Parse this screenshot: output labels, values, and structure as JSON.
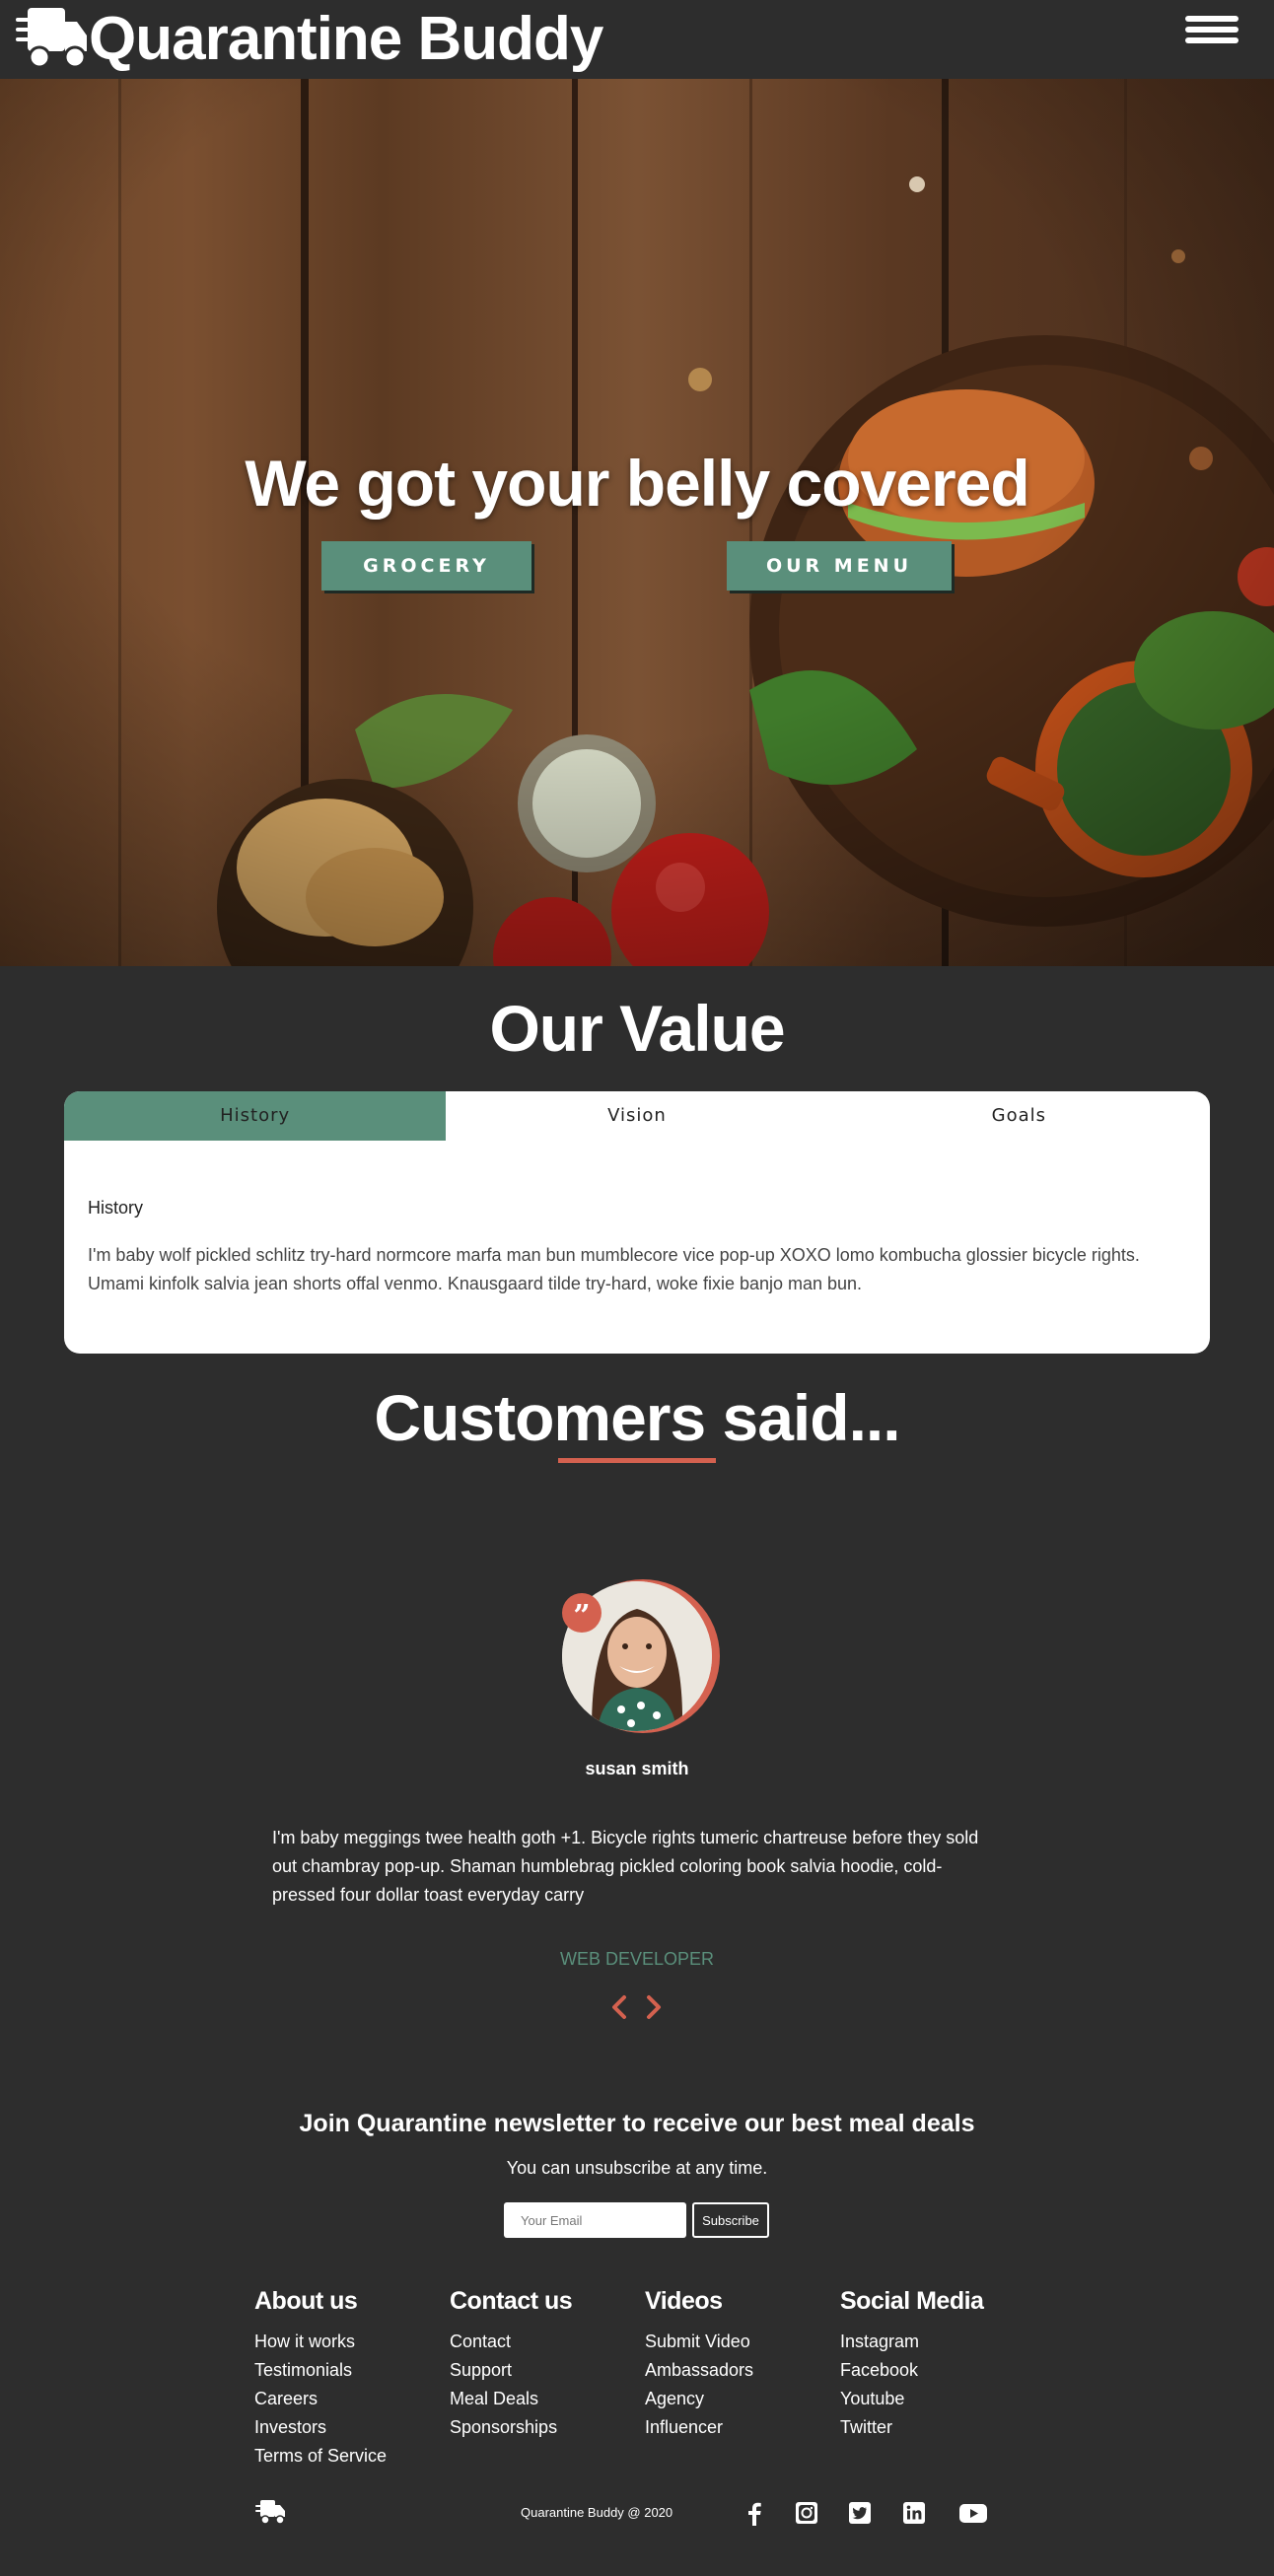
{
  "nav": {
    "brand": "Quarantine Buddy"
  },
  "hero": {
    "headline": "We got your belly covered",
    "buttons": {
      "grocery": "GROCERY",
      "menu": "OUR MENU"
    }
  },
  "value": {
    "title": "Our Value",
    "tabs": [
      "History",
      "Vision",
      "Goals"
    ],
    "active_heading": "History",
    "active_text": "I'm baby wolf pickled schlitz try-hard normcore marfa man bun mumblecore vice pop-up XOXO lomo kombucha glossier bicycle rights. Umami kinfolk salvia jean shorts offal venmo. Knausgaard tilde try-hard, woke fixie banjo man bun."
  },
  "testimonials": {
    "title": "Customers said...",
    "name": "susan smith",
    "text": "I'm baby meggings twee health goth +1. Bicycle rights tumeric chartreuse before they sold out chambray pop-up. Shaman humblebrag pickled coloring book salvia hoodie, cold-pressed four dollar toast everyday carry",
    "role": "WEB DEVELOPER"
  },
  "newsletter": {
    "title": "Join Quarantine newsletter to receive our best meal deals",
    "subtitle": "You can unsubscribe at any time.",
    "placeholder": "Your Email",
    "button": "Subscribe"
  },
  "footer": {
    "columns": [
      {
        "title": "About us",
        "links": [
          "How it works",
          "Testimonials",
          "Careers",
          "Investors",
          "Terms of Service"
        ]
      },
      {
        "title": "Contact us",
        "links": [
          "Contact",
          "Support",
          "Meal Deals",
          "Sponsorships"
        ]
      },
      {
        "title": "Videos",
        "links": [
          "Submit Video",
          "Ambassadors",
          "Agency",
          "Influencer"
        ]
      },
      {
        "title": "Social Media",
        "links": [
          "Instagram",
          "Facebook",
          "Youtube",
          "Twitter"
        ]
      }
    ],
    "copyright": "Quarantine Buddy @ 2020",
    "social_icons": [
      "facebook-icon",
      "instagram-icon",
      "twitter-icon",
      "linkedin-icon",
      "youtube-icon"
    ]
  },
  "colors": {
    "accent_green": "#5a8f7b",
    "accent_red": "#d4614f",
    "background": "#2d2d2d"
  }
}
